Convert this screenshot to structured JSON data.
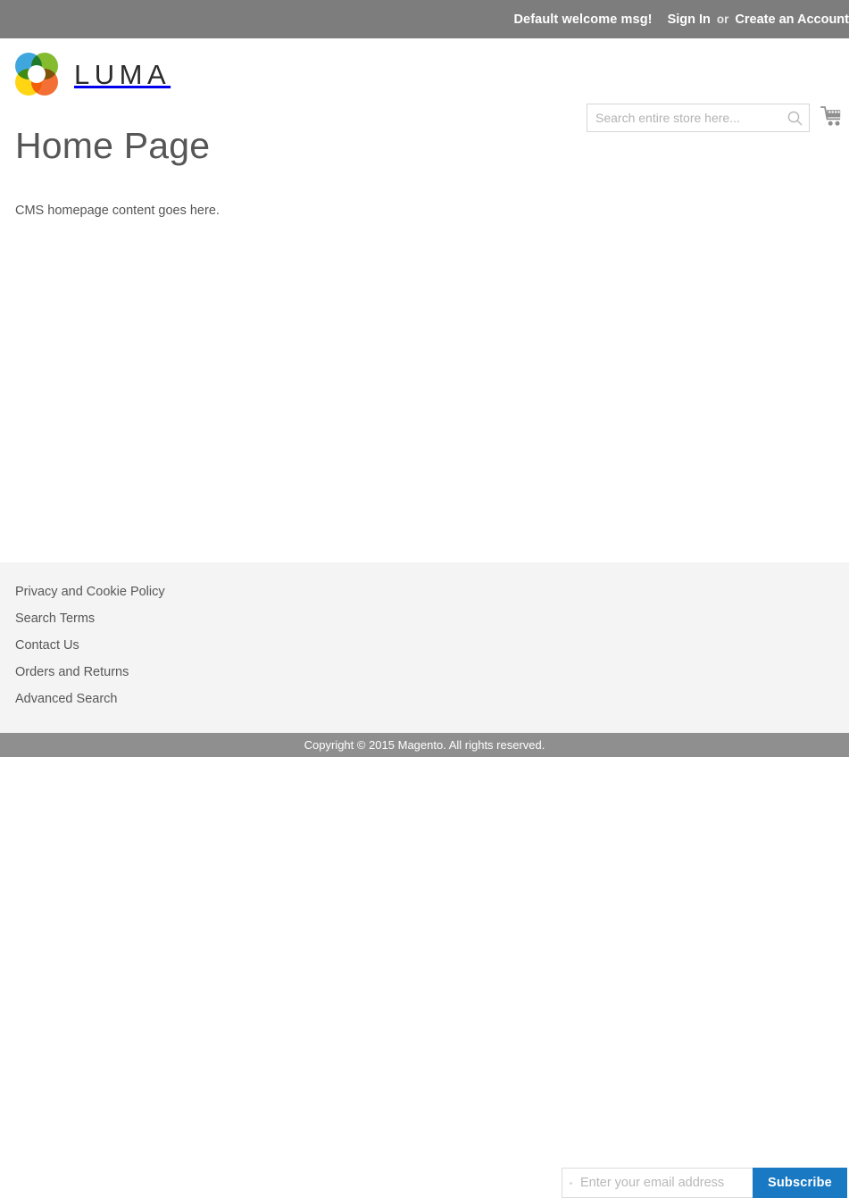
{
  "top_panel": {
    "welcome_message": "Default welcome msg!",
    "sign_in_label": "Sign In",
    "separator": "or",
    "create_account_label": "Create an Account",
    "background_color": "#7d7d7d"
  },
  "header": {
    "logo_text": "LUMA",
    "logo_icon": "luma-loop-icon",
    "logo_colors": {
      "blue": "#2fa0dc",
      "green": "#7ab51d",
      "orange": "#f26322",
      "yellow": "#ffd200"
    },
    "search": {
      "placeholder": "Search entire store here...",
      "value": "",
      "icon": "search-icon"
    },
    "cart": {
      "icon": "shopping-cart-icon",
      "count": ""
    }
  },
  "main": {
    "page_title": "Home Page",
    "content_text": "CMS homepage content goes here."
  },
  "footer": {
    "background_color": "#f4f4f4",
    "links": [
      {
        "label": "Privacy and Cookie Policy"
      },
      {
        "label": "Search Terms"
      },
      {
        "label": "Contact Us"
      },
      {
        "label": "Orders and Returns"
      },
      {
        "label": "Advanced Search"
      }
    ],
    "newsletter": {
      "icon": "envelope-icon",
      "placeholder": "Enter your email address",
      "value": "",
      "subscribe_label": "Subscribe",
      "subscribe_color": "#1979c3"
    }
  },
  "copyright": {
    "text": "Copyright © 2015 Magento. All rights reserved.",
    "background_color": "#8f8f8f"
  }
}
